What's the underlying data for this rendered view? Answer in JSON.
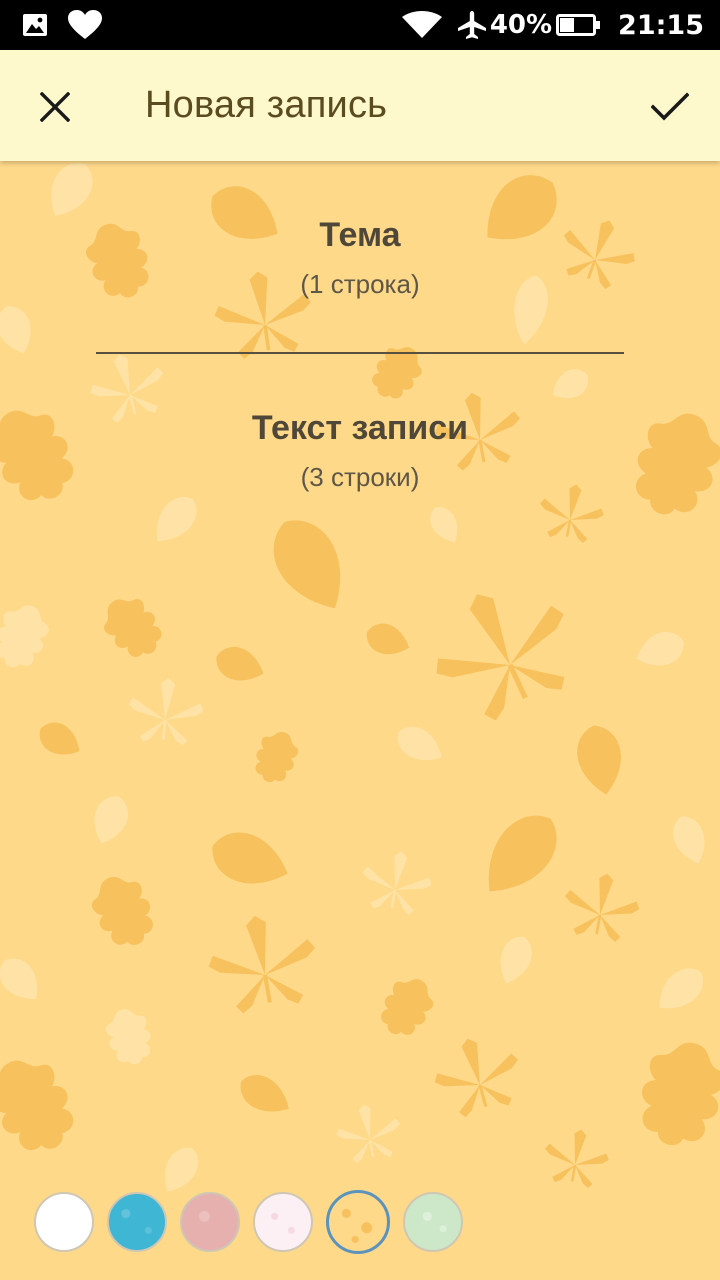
{
  "status_bar": {
    "battery_percent": "40%",
    "time": "21:15",
    "icons": [
      "gallery-icon",
      "heart-icon",
      "wifi-icon",
      "airplane-mode-icon",
      "battery-icon"
    ]
  },
  "app_bar": {
    "title": "Новая запись",
    "close_icon": "close-icon",
    "confirm_icon": "checkmark-icon"
  },
  "form": {
    "subject": {
      "label": "Тема",
      "hint": "(1 строка)"
    },
    "body": {
      "label": "Текст записи",
      "hint": "(3 строки)"
    }
  },
  "backgrounds": {
    "selected_index": 4,
    "swatches": [
      {
        "name": "white",
        "color": "#ffffff"
      },
      {
        "name": "blue",
        "color": "#3fb6d3"
      },
      {
        "name": "pink",
        "color": "#e6b0ae"
      },
      {
        "name": "light-pink",
        "color": "#fdf0f4"
      },
      {
        "name": "autumn-leaves",
        "color": "#ffd98a"
      },
      {
        "name": "mint",
        "color": "#cde8c8"
      }
    ]
  },
  "colors": {
    "page_background": "#ffd98a",
    "leaf": "#f7c25e",
    "leaf_faint": "#ffe3a6",
    "app_bar": "#fef8cd",
    "title_text": "#5b4c20",
    "selected_ring": "#5b93bd"
  }
}
